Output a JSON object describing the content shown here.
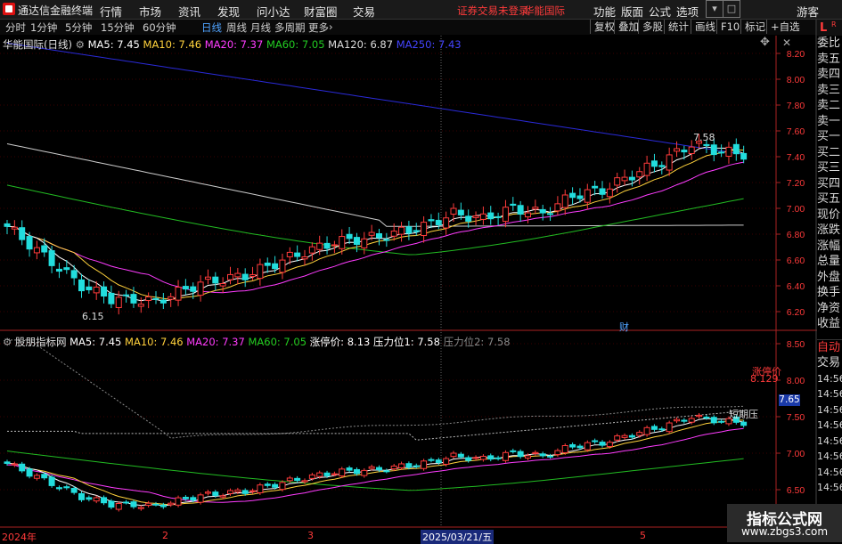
{
  "titlebar": {
    "app_name": "通达信金融终端",
    "menus": [
      "行情",
      "市场",
      "资讯",
      "发现",
      "问小达",
      "财富圈",
      "交易"
    ],
    "notice": "证券交易未登录",
    "notice_stock": "华能国际",
    "right_menus": [
      "功能",
      "版面",
      "公式",
      "选项"
    ],
    "guest": "游客"
  },
  "toolbar": {
    "periods": [
      "分时",
      "1分钟",
      "5分钟",
      "15分钟",
      "60分钟",
      "日线",
      "周线",
      "月线",
      "多周期",
      "更多"
    ],
    "active_period": "日线",
    "buttons": [
      "复权",
      "叠加",
      "多股",
      "统计",
      "画线",
      "F10",
      "标记",
      "+自选"
    ]
  },
  "side_panel": {
    "corner_label": "L",
    "items": [
      "委比",
      "卖五",
      "卖四",
      "卖三",
      "卖二",
      "卖一",
      "买一",
      "买二",
      "买三",
      "买四",
      "买五",
      "现价",
      "涨跌",
      "涨幅",
      "总量",
      "外盘",
      "换手",
      "净资",
      "收益",
      "自动",
      "交易"
    ],
    "lower_times": [
      "14:56",
      "14:56",
      "14:56",
      "14:56",
      "14:56",
      "14:56",
      "14:56",
      "14:56",
      "14:56"
    ]
  },
  "main_chart": {
    "stock": "华能国际(日线)",
    "legend": [
      {
        "label": "MA5: 7.45",
        "color": "#ffffff"
      },
      {
        "label": "MA10: 7.46",
        "color": "#ffd23c"
      },
      {
        "label": "MA20: 7.37",
        "color": "#ff3cff"
      },
      {
        "label": "MA60: 7.05",
        "color": "#22cc22"
      },
      {
        "label": "MA120: 6.87",
        "color": "#dddddd"
      },
      {
        "label": "MA250: 7.43",
        "color": "#3333ff"
      }
    ],
    "y_ticks": [
      "8.20",
      "8.00",
      "7.80",
      "7.60",
      "7.40",
      "7.20",
      "7.00",
      "6.80",
      "6.60",
      "6.40",
      "6.20"
    ],
    "high_label": "7.58",
    "low_label": "6.15",
    "fin_marker": "财"
  },
  "sub_chart": {
    "name": "股朋指标网",
    "legend": [
      {
        "label": "MA5: 7.45",
        "color": "#ffffff"
      },
      {
        "label": "MA10: 7.46",
        "color": "#ffd23c"
      },
      {
        "label": "MA20: 7.37",
        "color": "#ff3cff"
      },
      {
        "label": "MA60: 7.05",
        "color": "#22cc22"
      },
      {
        "label": "涨停价: 8.13",
        "color": "#ffffff"
      },
      {
        "label": "压力位1: 7.58",
        "color": "#ffffff"
      },
      {
        "label": "压力位2: 7.58",
        "color": "#888888"
      }
    ],
    "y_ticks": [
      "8.50",
      "8.00",
      "7.50",
      "7.00",
      "6.50"
    ],
    "limit_label": "涨停价",
    "limit_value": "8.129",
    "short_pressure": "短期压",
    "price_box": "7.65"
  },
  "x_axis": {
    "labels": [
      "2024年",
      "2",
      "3",
      "2025/03/21/五",
      "5"
    ]
  },
  "watermark": {
    "title": "指标公式网",
    "url": "www.zbgs3.com"
  },
  "colors": {
    "up": "#ff3b3b",
    "down": "#22dddd",
    "background": "#000000",
    "axis_text": "#ff3a3a"
  }
}
